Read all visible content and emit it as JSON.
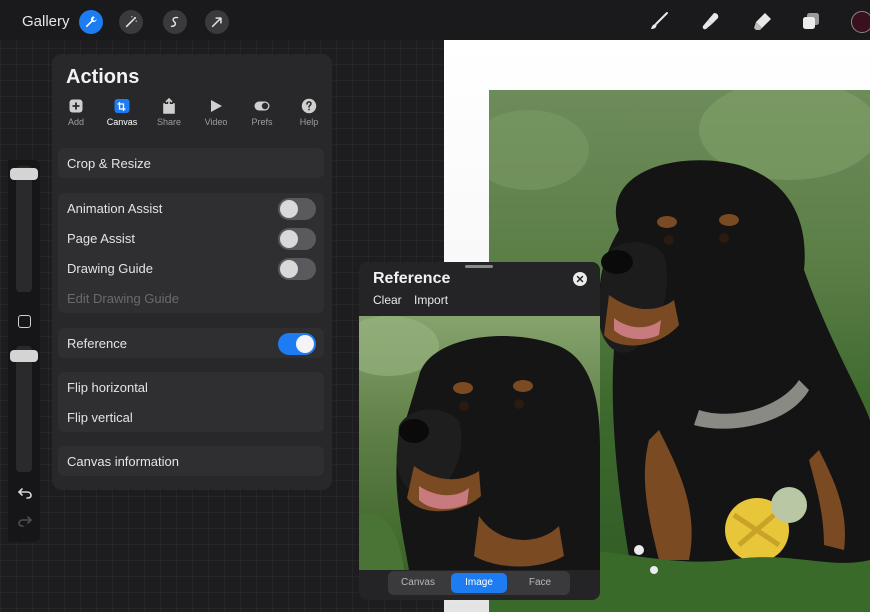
{
  "toolbar": {
    "gallery_label": "Gallery",
    "left_tools": [
      "wrench-icon",
      "magic-wand-icon",
      "selection-icon",
      "transform-arrow-icon"
    ],
    "right_tools": [
      "brush-icon",
      "smudge-icon",
      "eraser-icon",
      "layers-icon"
    ],
    "color": "#3a0f1e"
  },
  "actions": {
    "title": "Actions",
    "tabs": [
      {
        "label": "Add",
        "icon": "add-icon"
      },
      {
        "label": "Canvas",
        "icon": "canvas-icon",
        "active": true
      },
      {
        "label": "Share",
        "icon": "share-icon"
      },
      {
        "label": "Video",
        "icon": "video-icon"
      },
      {
        "label": "Prefs",
        "icon": "prefs-toggle-icon"
      },
      {
        "label": "Help",
        "icon": "help-icon"
      }
    ],
    "crop_resize": "Crop & Resize",
    "animation_assist": {
      "label": "Animation Assist",
      "on": false
    },
    "page_assist": {
      "label": "Page Assist",
      "on": false
    },
    "drawing_guide": {
      "label": "Drawing Guide",
      "on": false
    },
    "edit_drawing_guide": "Edit Drawing Guide",
    "reference": {
      "label": "Reference",
      "on": true
    },
    "flip_horizontal": "Flip horizontal",
    "flip_vertical": "Flip vertical",
    "canvas_information": "Canvas information"
  },
  "reference_panel": {
    "title": "Reference",
    "clear": "Clear",
    "import": "Import",
    "modes": [
      "Canvas",
      "Image",
      "Face"
    ],
    "active_mode": "Image"
  },
  "colors": {
    "accent": "#1d7cf2",
    "panel": "#28282a",
    "toggle_off": "#5a5a5e"
  }
}
